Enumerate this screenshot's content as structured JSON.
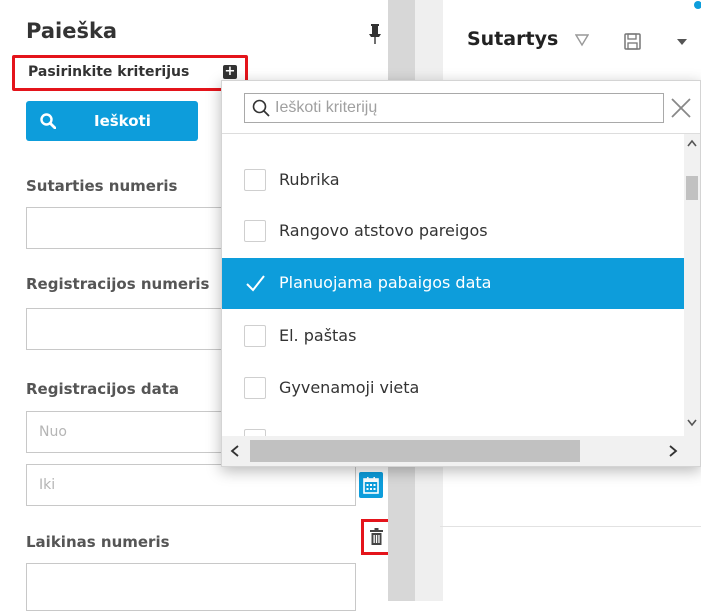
{
  "search_panel": {
    "title": "Paieška",
    "criteria_label": "Pasirinkite kriterijus",
    "plus_symbol": "+",
    "search_button_label": "Ieškoti",
    "fields": {
      "contract_number_label": "Sutarties numeris",
      "registration_number_label": "Registracijos numeris",
      "registration_date_label": "Registracijos data",
      "date_from_placeholder": "Nuo",
      "date_to_placeholder": "Iki",
      "temporary_number_label": "Laikinas numeris"
    }
  },
  "right_pane": {
    "title": "Sutartys"
  },
  "criteria_dropdown": {
    "search_placeholder": "Ieškoti kriterijų",
    "items": [
      {
        "label": "Rubrika",
        "checked": false
      },
      {
        "label": "Rangovo atstovo pareigos",
        "checked": false
      },
      {
        "label": "Planuojama pabaigos data",
        "checked": true
      },
      {
        "label": "El. paštas",
        "checked": false
      },
      {
        "label": "Gyvenamoji vieta",
        "checked": false
      }
    ]
  },
  "colors": {
    "accent": "#0d9ddb",
    "highlight_border": "#e4141b"
  },
  "icons": [
    "pin-icon",
    "plus-icon",
    "search-icon",
    "calendar-icon",
    "trash-icon",
    "filter-icon",
    "save-icon",
    "chevron-down-icon",
    "close-icon",
    "check-icon"
  ]
}
